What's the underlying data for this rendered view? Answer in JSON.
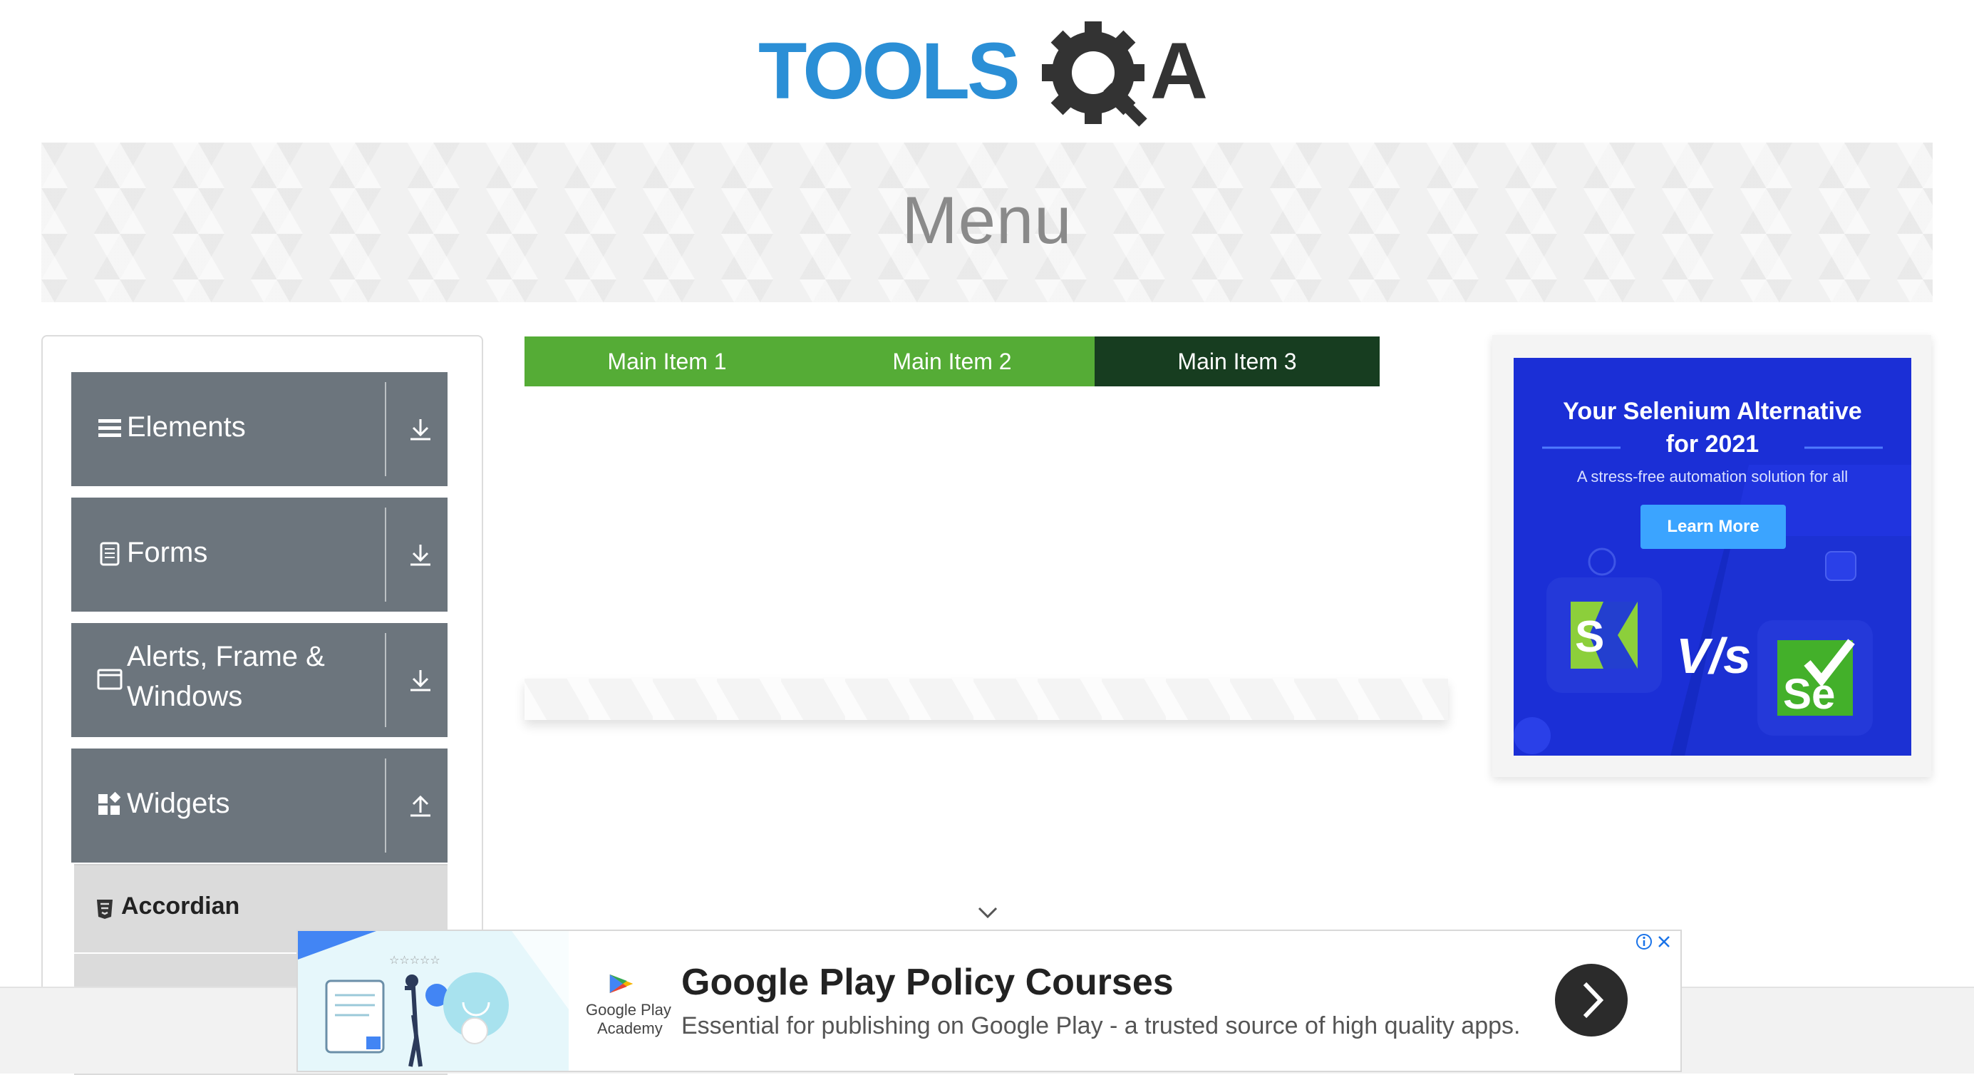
{
  "header": {
    "logo_text": "TOOLSQA"
  },
  "banner": {
    "title": "Menu"
  },
  "sidebar": {
    "groups": [
      {
        "label": "Elements",
        "icon": "hamburger-icon",
        "arrow": "download-arrow-icon"
      },
      {
        "label": "Forms",
        "icon": "document-icon",
        "arrow": "download-arrow-icon"
      },
      {
        "label": "Alerts, Frame &",
        "label2": "Windows",
        "icon": "window-icon",
        "arrow": "download-arrow-icon"
      },
      {
        "label": "Widgets",
        "icon": "widgets-icon",
        "arrow": "upload-arrow-icon"
      }
    ],
    "active_item": {
      "label": "Accordian",
      "icon": "html5-icon"
    }
  },
  "menu": {
    "items": [
      {
        "label": "Main Item 1"
      },
      {
        "label": "Main Item 2"
      },
      {
        "label": "Main Item 3"
      }
    ],
    "active_index": 2
  },
  "side_ad": {
    "title_line1": "Your Selenium Alternative",
    "title_line2": "for 2021",
    "subtitle": "A stress-free automation solution for all",
    "button": "Learn More",
    "vs_text": "V/s",
    "left_logo": "S",
    "right_logo": "Se"
  },
  "bottom_ad": {
    "brand_line1": "Google Play",
    "brand_line2": "Academy",
    "title": "Google Play Policy Courses",
    "subtitle": "Essential for publishing on Google Play - a trusted source of high quality apps."
  },
  "colors": {
    "menu_green": "#55ac36",
    "menu_active": "#173d20",
    "sidebar_group": "#6c757d",
    "ad_blue": "#1b2fd6",
    "logo_blue": "#2b8fd6",
    "logo_dark": "#333333"
  }
}
